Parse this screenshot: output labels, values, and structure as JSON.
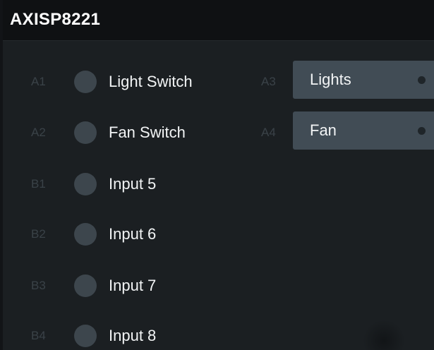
{
  "window": {
    "title": "AXISP8221"
  },
  "inputs": [
    {
      "port": "A1",
      "label": "Light Switch"
    },
    {
      "port": "A2",
      "label": "Fan Switch"
    },
    {
      "port": "B1",
      "label": "Input 5"
    },
    {
      "port": "B2",
      "label": "Input 6"
    },
    {
      "port": "B3",
      "label": "Input 7"
    },
    {
      "port": "B4",
      "label": "Input 8"
    }
  ],
  "outputs": [
    {
      "port": "A3",
      "label": "Lights"
    },
    {
      "port": "A4",
      "label": "Fan"
    }
  ],
  "colors": {
    "background": "#1b1f22",
    "titlebar": "#0f1113",
    "button": "#414c55",
    "led_off": "#3d464d",
    "port_text": "#3a4248"
  }
}
